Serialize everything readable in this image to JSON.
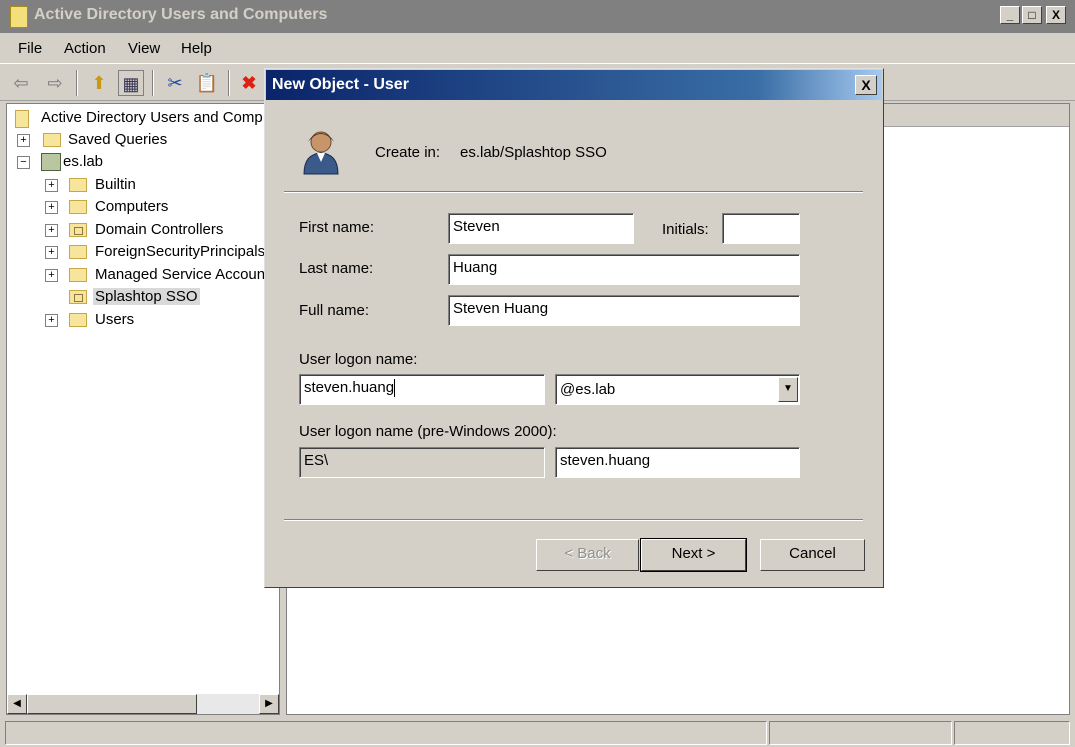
{
  "window": {
    "title": "Active Directory Users and Computers",
    "controls": {
      "minimize": "_",
      "maximize": "□",
      "close": "X"
    }
  },
  "menu": {
    "items": [
      "File",
      "Action",
      "View",
      "Help"
    ]
  },
  "toolbar": {
    "icons": [
      "back-arrow-icon",
      "forward-arrow-icon",
      "up-folder-icon",
      "console-tree-icon",
      "cut-icon",
      "clipboard-icon",
      "delete-icon"
    ]
  },
  "tree": {
    "root": "Active Directory Users and Comp",
    "items": [
      {
        "label": "Saved Queries",
        "expander": "+"
      },
      {
        "label": "es.lab",
        "expander": "−"
      },
      {
        "label": "Builtin",
        "expander": "+"
      },
      {
        "label": "Computers",
        "expander": "+"
      },
      {
        "label": "Domain Controllers",
        "expander": "+"
      },
      {
        "label": "ForeignSecurityPrincipals",
        "expander": "+"
      },
      {
        "label": "Managed Service Accoun",
        "expander": "+"
      },
      {
        "label": "Splashtop SSO",
        "expander": ""
      },
      {
        "label": "Users",
        "expander": "+"
      }
    ]
  },
  "dialog": {
    "title": "New Object - User",
    "close": "X",
    "create_in_label": "Create in:",
    "create_in_value": "es.lab/Splashtop SSO",
    "first_name_label": "First name:",
    "first_name_value": "Steven",
    "initials_label": "Initials:",
    "initials_value": "",
    "last_name_label": "Last name:",
    "last_name_value": "Huang",
    "full_name_label": "Full name:",
    "full_name_value": "Steven Huang",
    "logon_label": "User logon name:",
    "logon_value": "steven.huang",
    "domain_value": "@es.lab",
    "pre2000_label": "User logon name (pre-Windows 2000):",
    "pre2000_domain": "ES\\",
    "pre2000_value": "steven.huang",
    "back_label": "< Back",
    "next_label": "Next >",
    "cancel_label": "Cancel"
  }
}
